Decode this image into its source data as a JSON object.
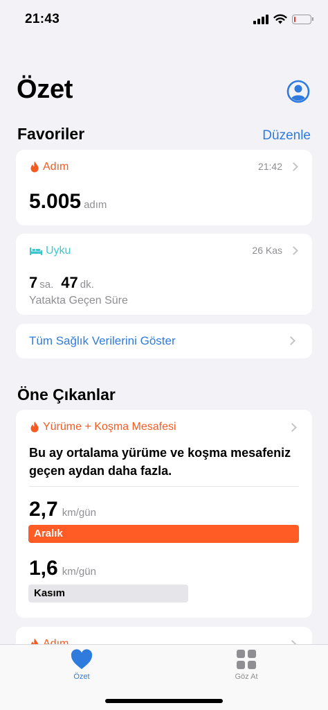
{
  "status_bar": {
    "time": "21:43",
    "battery_level": 0.1
  },
  "header": {
    "title": "Özet"
  },
  "favorites": {
    "title": "Favoriler",
    "edit_label": "Düzenle",
    "steps": {
      "label": "Adım",
      "time": "21:42",
      "value": "5.005",
      "unit": "adım"
    },
    "sleep": {
      "label": "Uyku",
      "date": "26 Kas",
      "hours": "7",
      "hours_unit": "sa.",
      "minutes": "47",
      "minutes_unit": "dk.",
      "caption": "Yatakta Geçen Süre"
    },
    "show_all_label": "Tüm Sağlık Verilerini Göster"
  },
  "highlights": {
    "title": "Öne Çıkanlar",
    "distance": {
      "label": "Yürüme + Koşma Mesafesi",
      "description": "Bu ay ortalama yürüme ve koşma mesafeniz geçen aydan daha fazla.",
      "current": {
        "value": "2,7",
        "unit": "km/gün",
        "month": "Aralık",
        "fraction": 1.0
      },
      "previous": {
        "value": "1,6",
        "unit": "km/gün",
        "month": "Kasım",
        "fraction": 0.59
      }
    },
    "next_card_label": "Adım"
  },
  "tab_bar": {
    "tabs": [
      {
        "label": "Özet",
        "active": true
      },
      {
        "label": "Göz At",
        "active": false
      }
    ]
  },
  "colors": {
    "accent": "#2f7bdd",
    "activity": "#f35b22",
    "sleep": "#3cc7cf"
  }
}
